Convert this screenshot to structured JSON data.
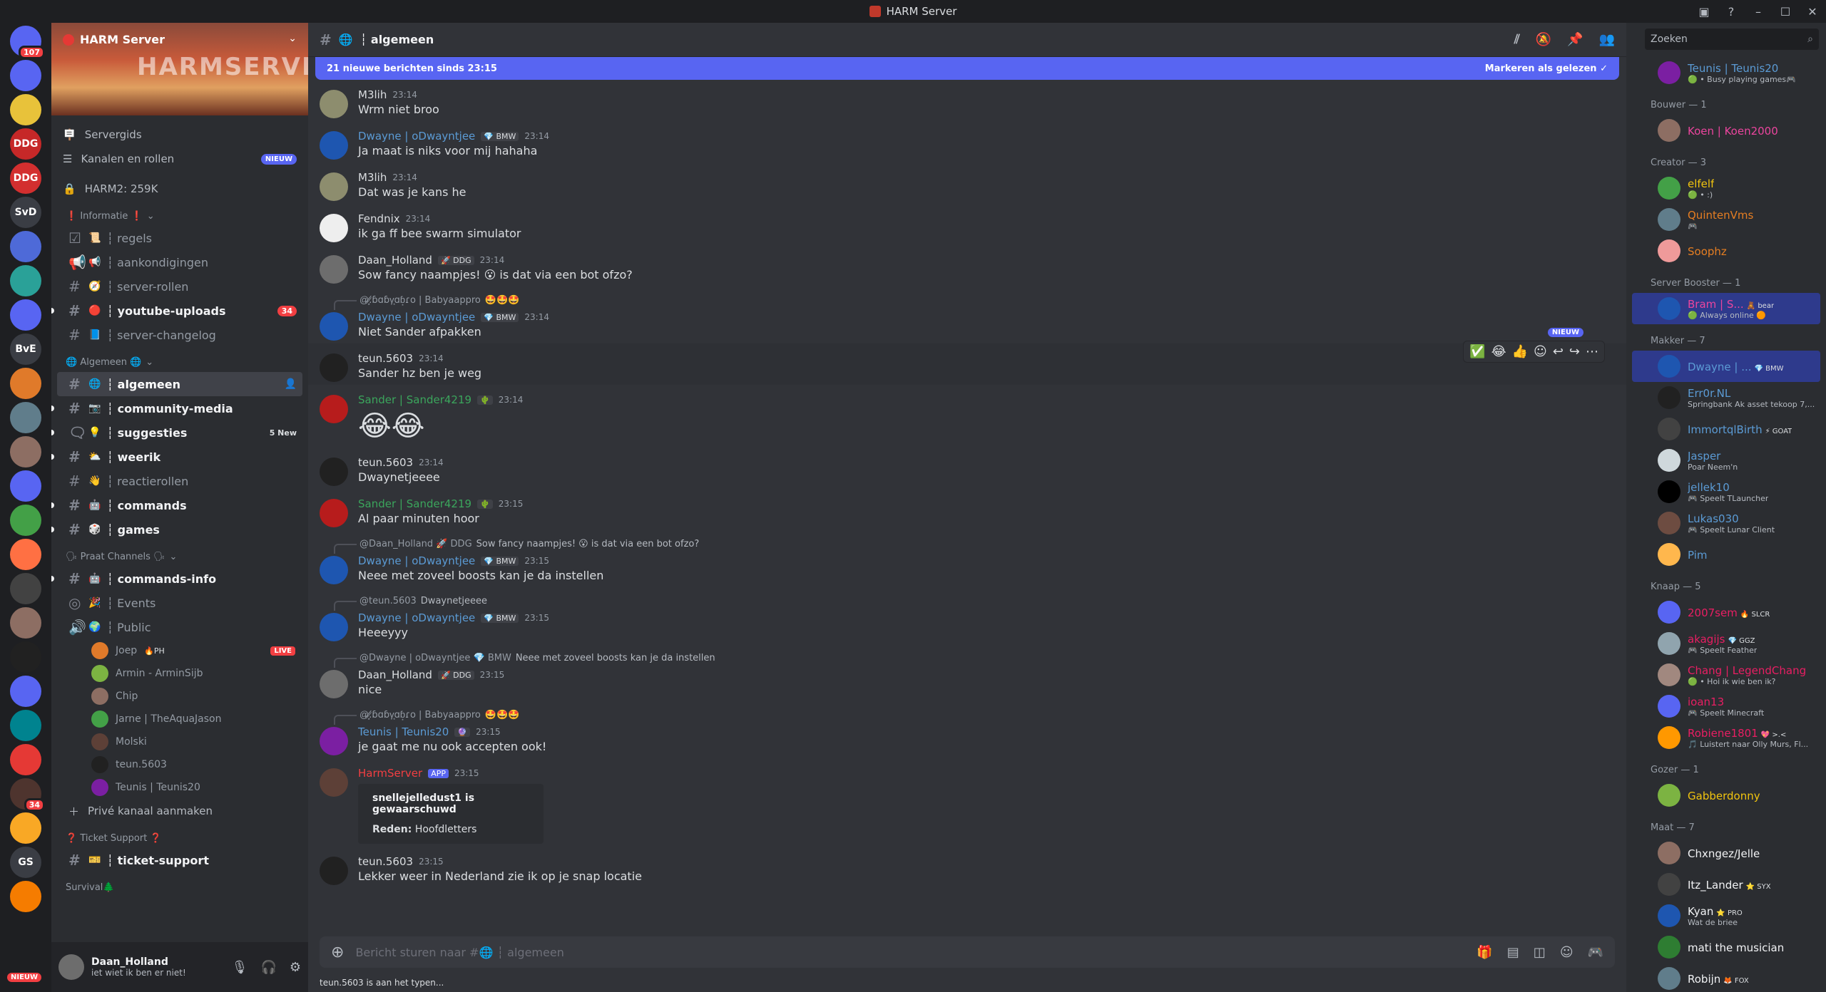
{
  "window": {
    "title": "HARM Server"
  },
  "guilds": [
    {
      "label": "",
      "color": "#5865f2",
      "badge": "107"
    },
    {
      "label": "",
      "color": "#5865f2",
      "badge": ""
    },
    {
      "label": "",
      "color": "#e8c23a",
      "badge": ""
    },
    {
      "label": "DDG",
      "color": "#c62828",
      "badge": ""
    },
    {
      "label": "DDG",
      "color": "#d32f2f",
      "badge": ""
    },
    {
      "label": "SvD",
      "color": "#3a3d44",
      "badge": ""
    },
    {
      "label": "",
      "color": "#4e6ad8",
      "badge": ""
    },
    {
      "label": "",
      "color": "#2aa198",
      "badge": ""
    },
    {
      "label": "",
      "color": "#5865f2",
      "badge": ""
    },
    {
      "label": "BvE",
      "color": "#3a3d44",
      "badge": ""
    },
    {
      "label": "",
      "color": "#e07a2a",
      "badge": ""
    },
    {
      "label": "",
      "color": "#607d8b",
      "badge": ""
    },
    {
      "label": "",
      "color": "#8d6e63",
      "badge": ""
    },
    {
      "label": "",
      "color": "#5865f2",
      "badge": ""
    },
    {
      "label": "",
      "color": "#43a047",
      "badge": ""
    },
    {
      "label": "",
      "color": "#ff7043",
      "badge": ""
    },
    {
      "label": "",
      "color": "#424242",
      "badge": ""
    },
    {
      "label": "",
      "color": "#8d6e63",
      "badge": ""
    },
    {
      "label": "",
      "color": "#212121",
      "badge": ""
    },
    {
      "label": "",
      "color": "#5865f2",
      "badge": ""
    },
    {
      "label": "",
      "color": "#00838f",
      "badge": ""
    },
    {
      "label": "",
      "color": "#e53935",
      "badge": ""
    },
    {
      "label": "",
      "color": "#4e342e",
      "badge": "34"
    },
    {
      "label": "",
      "color": "#f9a825",
      "badge": ""
    },
    {
      "label": "GS",
      "color": "#3a3d44",
      "badge": ""
    },
    {
      "label": "",
      "color": "#f57c00",
      "badge": ""
    }
  ],
  "guild_new": "NIEUW",
  "server": {
    "name": "HARM Server",
    "banner_text": "HARMSERVER",
    "top_items": [
      {
        "label": "Servergids",
        "icon": "signpost-icon",
        "new": ""
      },
      {
        "label": "Kanalen en rollen",
        "icon": "list-icon",
        "new": "NIEUW"
      }
    ],
    "lock_item": "HARM2: 259K",
    "categories": [
      {
        "name": "❗ Informatie ❗",
        "channels": [
          {
            "emoji": "📜",
            "name": "┆ regels",
            "state": "read",
            "badge": "",
            "icon": "rules"
          },
          {
            "emoji": "📢",
            "name": "┆ aankondigingen",
            "state": "read",
            "badge": "",
            "icon": "announce"
          },
          {
            "emoji": "🧭",
            "name": "┆ server-rollen",
            "state": "read",
            "badge": "",
            "icon": "hash"
          },
          {
            "emoji": "🔴",
            "name": "┆ youtube-uploads",
            "state": "unread",
            "badge": "34",
            "icon": "hash"
          },
          {
            "emoji": "📘",
            "name": "┆ server-changelog",
            "state": "read",
            "badge": "",
            "icon": "hash"
          }
        ]
      },
      {
        "name": "🌐 Algemeen 🌐",
        "channels": [
          {
            "emoji": "🌐",
            "name": "┆ algemeen",
            "state": "active",
            "badge": "",
            "icon": "hash"
          },
          {
            "emoji": "📷",
            "name": "┆ community-media",
            "state": "unread",
            "badge": "",
            "icon": "hash"
          },
          {
            "emoji": "💡",
            "name": "┆ suggesties",
            "state": "unread",
            "badge": "",
            "new": "5 New",
            "icon": "forum"
          },
          {
            "emoji": "⛅",
            "name": "┆ weerik",
            "state": "unread",
            "badge": "",
            "icon": "hash"
          },
          {
            "emoji": "👋",
            "name": "┆ reactierollen",
            "state": "read",
            "badge": "",
            "icon": "hash"
          },
          {
            "emoji": "🤖",
            "name": "┆ commands",
            "state": "unread",
            "badge": "",
            "icon": "hash"
          },
          {
            "emoji": "🎲",
            "name": "┆ games",
            "state": "unread",
            "badge": "",
            "icon": "hash"
          }
        ]
      },
      {
        "name": "🗣 Praat Channels 🗣",
        "channels": [
          {
            "emoji": "🤖",
            "name": "┆ commands-info",
            "state": "unread",
            "badge": "",
            "icon": "hash"
          },
          {
            "emoji": "🎉",
            "name": "┆ Events",
            "state": "read",
            "badge": "",
            "icon": "stage"
          },
          {
            "emoji": "🌍",
            "name": "┆ Public",
            "state": "read",
            "badge": "",
            "icon": "voice"
          }
        ]
      }
    ],
    "voice_users": [
      {
        "name": "Joep",
        "tag": "🔥PH",
        "live": "LIVE",
        "color": "#e07a2a"
      },
      {
        "name": "Armin - ArminSijb",
        "tag": "",
        "live": "",
        "color": "#7cb342"
      },
      {
        "name": "Chip",
        "tag": "",
        "live": "",
        "color": "#8d6e63"
      },
      {
        "name": "Jarne | TheAquaJason",
        "tag": "",
        "live": "",
        "color": "#43a047"
      },
      {
        "name": "Molski",
        "tag": "",
        "live": "",
        "color": "#5d4037"
      },
      {
        "name": "teun.5603",
        "tag": "",
        "live": "",
        "color": "#212121"
      },
      {
        "name": "Teunis | Teunis20",
        "tag": "",
        "live": "",
        "color": "#7b1fa2"
      }
    ],
    "private_channel": "Privé kanaal aanmaken",
    "ticket_category": "❓ Ticket Support ❓",
    "ticket_channel": "┆ ticket-support",
    "survival_category": "Survival🌲"
  },
  "user": {
    "name": "Daan_Holland",
    "status": "iet wiet ik ben er niet!"
  },
  "channel": {
    "name": "┆ algemeen",
    "new_banner": "21 nieuwe berichten sinds 23:15",
    "mark_read": "Markeren als gelezen"
  },
  "messages": [
    {
      "reply": null,
      "name": "M3lih",
      "color": "#dbdee1",
      "tag": "",
      "time": "23:14",
      "text": "Wrm niet broo",
      "avcolor": "#8d8d6e",
      "cont": false
    },
    {
      "reply": null,
      "name": "Dwayne | oDwayntjee",
      "color": "#5b9bd5",
      "tag": "💎 BMW",
      "time": "23:14",
      "text": "Ja maat is niks voor mij hahaha",
      "avcolor": "#1e56b0",
      "cont": false
    },
    {
      "reply": null,
      "name": "M3lih",
      "color": "#dbdee1",
      "tag": "",
      "time": "23:14",
      "text": "Dat was je kans he",
      "avcolor": "#8d8d6e",
      "cont": false
    },
    {
      "reply": null,
      "name": "Fendnix",
      "color": "#dbdee1",
      "tag": "",
      "time": "23:14",
      "text": "ik ga ff bee swarm simulator",
      "avcolor": "#eeeeee",
      "cont": false
    },
    {
      "reply": null,
      "name": "Daan_Holland",
      "color": "#dbdee1",
      "tag": "🚀 DDG",
      "time": "23:14",
      "text": "Sow fancy naampjes! 😮 is dat via een bot ofzo?",
      "avcolor": "#6d6d6d",
      "cont": false
    },
    {
      "reply": {
        "name": "@͙͙.̷̸ɓɑɓγ͙ɑɓ͙ɾo | Babyaappro",
        "text": "🤩🤩🤩"
      },
      "name": "Dwayne | oDwayntjee",
      "color": "#5b9bd5",
      "tag": "💎 BMW",
      "time": "23:14",
      "text": "Niet Sander afpakken",
      "avcolor": "#1e56b0",
      "cont": false
    },
    {
      "reply": null,
      "name": "teun.5603",
      "color": "#dbdee1",
      "tag": "",
      "time": "23:14",
      "text": "Sander hz ben je weg",
      "avcolor": "#212121",
      "cont": false,
      "hover": true
    },
    {
      "reply": null,
      "name": "Sander | Sander4219",
      "color": "#3ba55c",
      "tag": "🌵",
      "time": "23:14",
      "text": "😂😂",
      "avcolor": "#b71c1c",
      "cont": false,
      "big": true
    },
    {
      "reply": null,
      "name": "teun.5603",
      "color": "#dbdee1",
      "tag": "",
      "time": "23:14",
      "text": "Dwaynetjeeee",
      "avcolor": "#212121",
      "cont": false
    },
    {
      "reply": null,
      "name": "Sander | Sander4219",
      "color": "#3ba55c",
      "tag": "🌵",
      "time": "23:15",
      "text": "Al paar minuten hoor",
      "avcolor": "#b71c1c",
      "cont": false
    },
    {
      "reply": {
        "name": "@Daan_Holland 🚀 DDG",
        "text": "Sow fancy naampjes! 😮 is dat via een bot ofzo?"
      },
      "name": "Dwayne | oDwayntjee",
      "color": "#5b9bd5",
      "tag": "💎 BMW",
      "time": "23:15",
      "text": "Neee met zoveel boosts kan je da instellen",
      "avcolor": "#1e56b0",
      "cont": false
    },
    {
      "reply": {
        "name": "@teun.5603",
        "text": "Dwaynetjeeee"
      },
      "name": "Dwayne | oDwayntjee",
      "color": "#5b9bd5",
      "tag": "💎 BMW",
      "time": "23:15",
      "text": "Heeeyyy",
      "avcolor": "#1e56b0",
      "cont": false
    },
    {
      "reply": {
        "name": "@Dwayne | oDwayntjee 💎 BMW",
        "text": "Neee met zoveel boosts kan je da instellen"
      },
      "name": "Daan_Holland",
      "color": "#dbdee1",
      "tag": "🚀 DDG",
      "time": "23:15",
      "text": "nice",
      "avcolor": "#6d6d6d",
      "cont": false
    },
    {
      "reply": {
        "name": "@͙͙.̷̸ɓɑɓγ͙ɑɓ͙ɾo | Babyaappro",
        "text": "🤩🤩🤩"
      },
      "name": "Teunis | Teunis20",
      "color": "#5b9bd5",
      "tag": "🔮",
      "time": "23:15",
      "text": "je gaat me nu ook accepten ook!",
      "avcolor": "#7b1fa2",
      "cont": false
    },
    {
      "reply": null,
      "name": "HarmServer",
      "color": "#f23f42",
      "tag": "APP",
      "time": "23:15",
      "text": "",
      "avcolor": "#5d4037",
      "cont": false,
      "embed": {
        "title": "snellejelledust1 is gewaarschuwd",
        "reason_label": "Reden:",
        "reason": "Hoofdletters"
      }
    },
    {
      "reply": null,
      "name": "teun.5603",
      "color": "#dbdee1",
      "tag": "",
      "time": "23:15",
      "text": "Lekker weer in Nederland zie ik op je snap locatie",
      "avcolor": "#212121",
      "cont": false
    }
  ],
  "hover_new": "NIEUW",
  "input_placeholder": "Bericht sturen naar #🌐 ┆ algemeen",
  "typing": "teun.5603 is aan het typen...",
  "search_placeholder": "Zoeken",
  "members": [
    {
      "role": "",
      "users": [
        {
          "name": "Teunis | Teunis20",
          "status": "🟢 • Busy playing games🎮",
          "color": "#5b9bd5",
          "tag": "",
          "av": "#7b1fa2"
        }
      ]
    },
    {
      "role": "Bouwer — 1",
      "users": [
        {
          "name": "Koen | Koen2000",
          "status": "",
          "color": "#eb459e",
          "tag": "",
          "av": "#8d6e63"
        }
      ]
    },
    {
      "role": "Creator — 3",
      "users": [
        {
          "name": "elfelf",
          "status": "🟢 • :)",
          "color": "#f1c40f",
          "tag": "",
          "av": "#43a047"
        },
        {
          "name": "QuintenVms",
          "status": "🎮",
          "color": "#e67e22",
          "tag": "",
          "av": "#607d8b"
        },
        {
          "name": "Soophz",
          "status": "",
          "color": "#e67e22",
          "tag": "",
          "av": "#ef9a9a"
        }
      ]
    },
    {
      "role": "Server Booster — 1",
      "users": [
        {
          "name": "Bram | S...",
          "status": "🟢 Always online 🟠",
          "color": "#eb459e",
          "tag": "🧸 bear",
          "av": "#1e56b0",
          "hl": true
        }
      ]
    },
    {
      "role": "Makker — 7",
      "users": [
        {
          "name": "Dwayne | ...",
          "status": "",
          "color": "#5b9bd5",
          "tag": "💎 BMW",
          "av": "#1e56b0",
          "hl": true
        },
        {
          "name": "Err0r.NL",
          "status": "Springbank Ak asset tekoop 7,...",
          "color": "#5b9bd5",
          "tag": "",
          "av": "#212121"
        },
        {
          "name": "ImmortqlBirth",
          "status": "",
          "color": "#5b9bd5",
          "tag": "⚡ GOAT",
          "av": "#424242"
        },
        {
          "name": "Jasper",
          "status": "Poar Neem'n",
          "color": "#5b9bd5",
          "tag": "",
          "av": "#cfd8dc"
        },
        {
          "name": "jellek10",
          "status": "🎮 Speelt TLauncher",
          "color": "#5b9bd5",
          "tag": "",
          "av": "#000000"
        },
        {
          "name": "Lukas030",
          "status": "🎮 Speelt Lunar Client",
          "color": "#5b9bd5",
          "tag": "",
          "av": "#6d4c41"
        },
        {
          "name": "Pim",
          "status": "",
          "color": "#5b9bd5",
          "tag": "",
          "av": "#ffb74d"
        }
      ]
    },
    {
      "role": "Knaap — 5",
      "users": [
        {
          "name": "2007sem",
          "status": "",
          "color": "#e91e63",
          "tag": "🔥 SLCR",
          "av": "#5865f2"
        },
        {
          "name": "akagijs",
          "status": "🎮 Speelt Feather",
          "color": "#e91e63",
          "tag": "💎 GGZ",
          "av": "#90a4ae"
        },
        {
          "name": "Chang | LegendChang",
          "status": "🟢 • Hoi ik wie ben ik?",
          "color": "#e91e63",
          "tag": "",
          "av": "#a1887f"
        },
        {
          "name": "ioan13",
          "status": "🎮 Speelt Minecraft",
          "color": "#e91e63",
          "tag": "",
          "av": "#5865f2"
        },
        {
          "name": "Robiene1801",
          "status": "🎵 Luistert naar Olly Murs, Fl...",
          "color": "#e91e63",
          "tag": "💖 >.<",
          "av": "#ff9800"
        }
      ]
    },
    {
      "role": "Gozer — 1",
      "users": [
        {
          "name": "Gabberdonny",
          "status": "",
          "color": "#f1c40f",
          "tag": "",
          "av": "#7cb342"
        }
      ]
    },
    {
      "role": "Maat — 7",
      "users": [
        {
          "name": "Chxngez/Jelle",
          "status": "",
          "color": "#f2f3f5",
          "tag": "",
          "av": "#8d6e63"
        },
        {
          "name": "Itz_Lander",
          "status": "",
          "color": "#f2f3f5",
          "tag": "⭐ SYX",
          "av": "#424242"
        },
        {
          "name": "Kyan",
          "status": "Wat de briee",
          "color": "#f2f3f5",
          "tag": "⭐ PRO",
          "av": "#1e56b0"
        },
        {
          "name": "mati the musician",
          "status": "",
          "color": "#f2f3f5",
          "tag": "",
          "av": "#2e7d32"
        },
        {
          "name": "Robijn",
          "status": "",
          "color": "#f2f3f5",
          "tag": "🦊 FOX",
          "av": "#607d8b"
        }
      ]
    }
  ]
}
